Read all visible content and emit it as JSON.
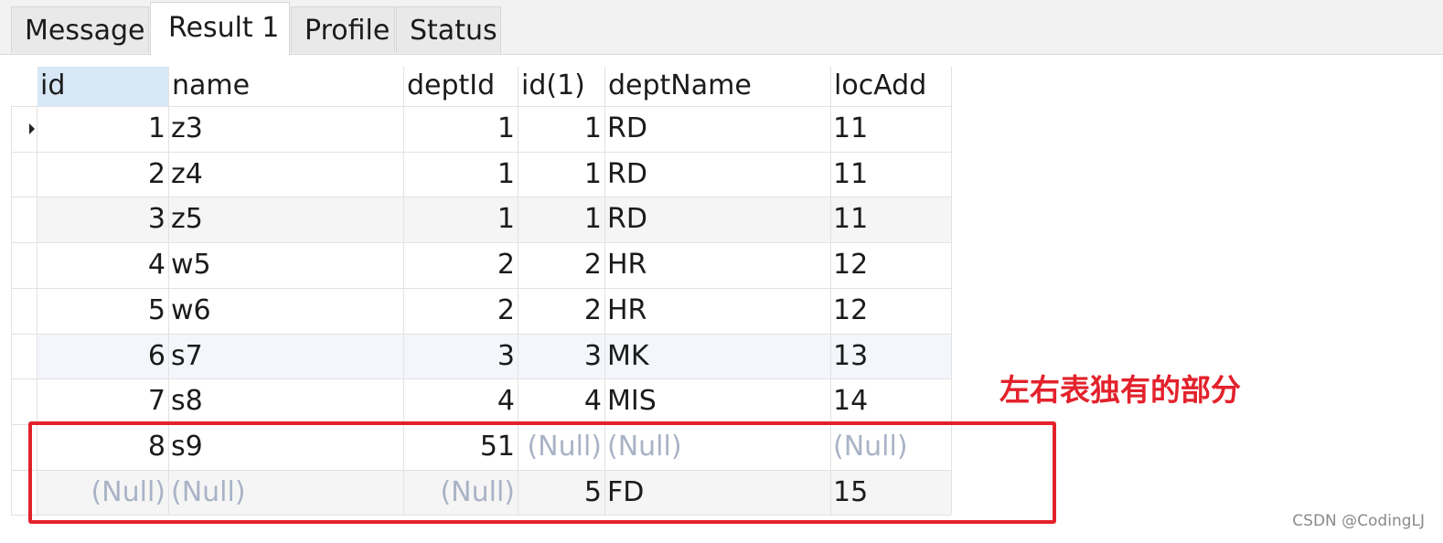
{
  "tabs": [
    {
      "label": "Message"
    },
    {
      "label": "Result 1"
    },
    {
      "label": "Profile"
    },
    {
      "label": "Status"
    }
  ],
  "active_tab": "Result 1",
  "grid": {
    "columns": [
      "id",
      "name",
      "deptId",
      "id(1)",
      "deptName",
      "locAdd"
    ],
    "rows": [
      [
        "1",
        "z3",
        "1",
        "1",
        "RD",
        "11"
      ],
      [
        "2",
        "z4",
        "1",
        "1",
        "RD",
        "11"
      ],
      [
        "3",
        "z5",
        "1",
        "1",
        "RD",
        "11"
      ],
      [
        "4",
        "w5",
        "2",
        "2",
        "HR",
        "12"
      ],
      [
        "5",
        "w6",
        "2",
        "2",
        "HR",
        "12"
      ],
      [
        "6",
        "s7",
        "3",
        "3",
        "MK",
        "13"
      ],
      [
        "7",
        "s8",
        "4",
        "4",
        "MIS",
        "14"
      ],
      [
        "8",
        "s9",
        "51",
        "(Null)",
        "(Null)",
        "(Null)"
      ],
      [
        "(Null)",
        "(Null)",
        "(Null)",
        "5",
        "FD",
        "15"
      ]
    ],
    "null_text": "(Null)",
    "null_color": "#a9b3c6"
  },
  "annotation": {
    "text": "左右表独有的部分",
    "color": "#e3222c"
  },
  "watermark": "CSDN @CodingLJ"
}
